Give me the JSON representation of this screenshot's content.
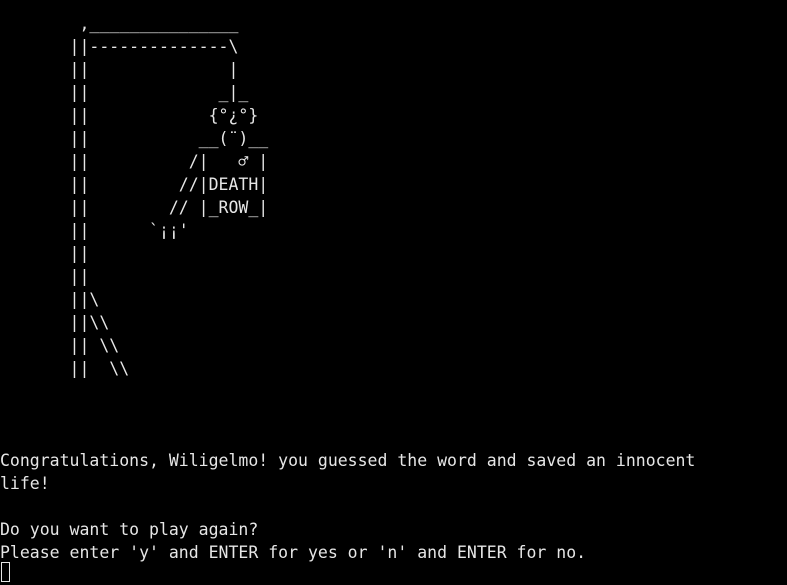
{
  "terminal": {
    "art": [
      "        ,_______________",
      "       ||--------------\\",
      "       ||              |",
      "       ||             _|_",
      "       ||            {°¿°}",
      "       ||           __(¨)__",
      "       ||          /|   ♂ |",
      "       ||         //|DEATH|",
      "       ||        // |_ROW_|",
      "       ||      `¡¡'",
      "       ||",
      "       ||",
      "       ||\\",
      "       ||\\\\",
      "       || \\\\",
      "       ||  \\\\"
    ],
    "messages": [
      "Congratulations, Wiligelmo! you guessed the word and saved an innocent",
      "life!",
      "",
      "Do you want to play again?",
      "Please enter 'y' and ENTER for yes or 'n' and ENTER for no."
    ]
  }
}
